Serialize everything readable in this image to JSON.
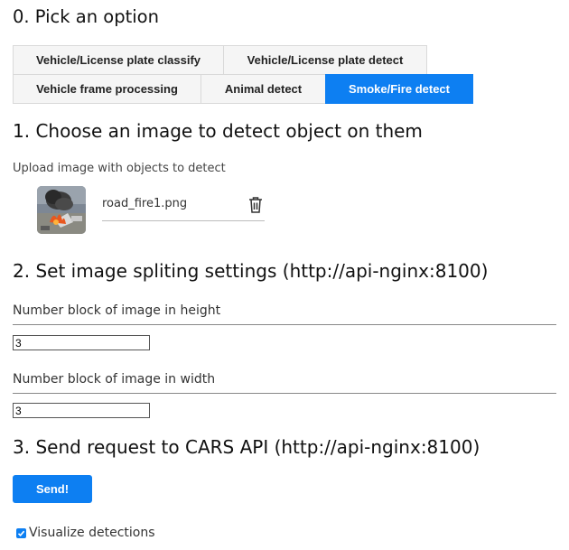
{
  "sections": {
    "pick": "0. Pick an option",
    "choose": "1. Choose an image to detect object on them",
    "split": "2. Set image spliting settings (http://api-nginx:8100)",
    "send": "3. Send request to CARS API (http://api-nginx:8100)"
  },
  "options": [
    {
      "label": "Vehicle/License plate classify",
      "active": false
    },
    {
      "label": "Vehicle/License plate detect",
      "active": false
    },
    {
      "label": "Vehicle frame processing",
      "active": false
    },
    {
      "label": "Animal detect",
      "active": false
    },
    {
      "label": "Smoke/Fire detect",
      "active": true
    }
  ],
  "upload": {
    "label": "Upload image with objects to detect",
    "file_name": "road_fire1.png",
    "thumbnail_icon": "image-thumbnail",
    "delete_icon": "trash-icon"
  },
  "settings": {
    "height_label": "Number block of image in height",
    "height_value": "3",
    "width_label": "Number block of image in width",
    "width_value": "3"
  },
  "send_button": "Send!",
  "visualize": {
    "label": "Visualize detections",
    "checked": true
  },
  "colors": {
    "accent": "#0d7ff2",
    "option_bg": "#f5f5f5"
  }
}
